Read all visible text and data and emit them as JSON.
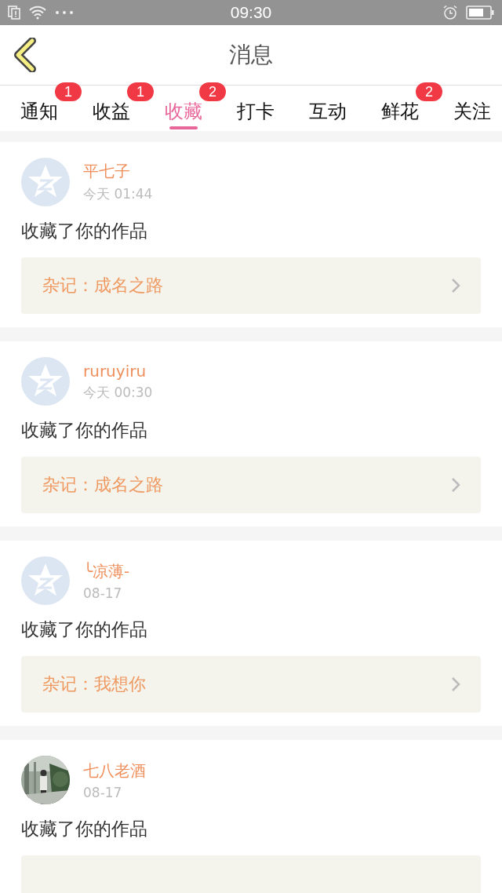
{
  "status_bar": {
    "time": "09:30"
  },
  "header": {
    "title": "消息"
  },
  "tabs": [
    {
      "label": "通知",
      "badge": "1",
      "selected": false
    },
    {
      "label": "收益",
      "badge": "1",
      "selected": false
    },
    {
      "label": "收藏",
      "badge": "2",
      "selected": true
    },
    {
      "label": "打卡",
      "selected": false
    },
    {
      "label": "互动",
      "selected": false
    },
    {
      "label": "鲜花",
      "badge": "2",
      "selected": false
    },
    {
      "label": "关注",
      "selected": false
    }
  ],
  "messages": [
    {
      "avatar": {
        "kind": "default"
      },
      "name": "平七子",
      "time": "今天 01:44",
      "action": "收藏了你的作品",
      "work": "杂记：成名之路"
    },
    {
      "avatar": {
        "kind": "default"
      },
      "name": "ruruyiru",
      "time": "今天 00:30",
      "action": "收藏了你的作品",
      "work": "杂记：成名之路"
    },
    {
      "avatar": {
        "kind": "default"
      },
      "name": "╰凉薄-",
      "time": "08-17",
      "action": "收藏了你的作品",
      "work": "杂记：我想你"
    },
    {
      "name": "七八老酒",
      "time": "08-17",
      "action": "收藏了你的作品"
    }
  ]
}
